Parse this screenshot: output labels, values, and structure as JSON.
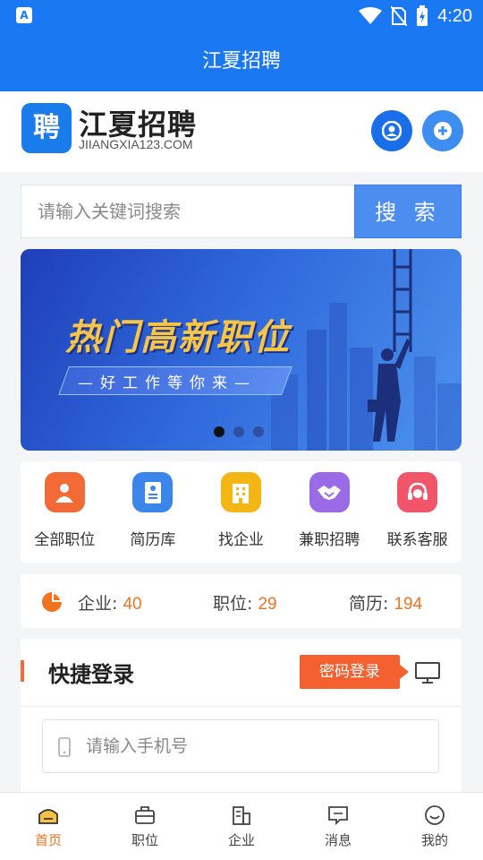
{
  "statusbar": {
    "time": "4:20",
    "app_badge": "A"
  },
  "titlebar": {
    "title": "江夏招聘"
  },
  "header": {
    "logo_char": "聘",
    "site_name": "江夏招聘",
    "domain": "JIIANGXIA123.COM"
  },
  "search": {
    "placeholder": "请输入关键词搜索",
    "button_label": "搜 索"
  },
  "banner": {
    "title": "热门高新职位",
    "subtitle": "—好工作等你来—",
    "slide_count": 3,
    "active_slide": 0
  },
  "menu": {
    "items": [
      {
        "label": "全部职位",
        "icon": "briefcase-person-icon",
        "color": "#f26a35"
      },
      {
        "label": "简历库",
        "icon": "resume-icon",
        "color": "#3a86ea"
      },
      {
        "label": "找企业",
        "icon": "building-icon",
        "color": "#f3b614"
      },
      {
        "label": "兼职招聘",
        "icon": "handshake-icon",
        "color": "#9b6ae6"
      },
      {
        "label": "联系客服",
        "icon": "headset-icon",
        "color": "#f0556a"
      }
    ]
  },
  "stats": {
    "company_label": "企业:",
    "company_count": "40",
    "job_label": "职位:",
    "job_count": "29",
    "resume_label": "简历:",
    "resume_count": "194"
  },
  "login": {
    "title": "快捷登录",
    "password_login_label": "密码登录",
    "phone_placeholder": "请输入手机号"
  },
  "tabbar": {
    "items": [
      {
        "label": "首页",
        "icon": "home-icon",
        "active": true
      },
      {
        "label": "职位",
        "icon": "briefcase-icon",
        "active": false
      },
      {
        "label": "企业",
        "icon": "company-icon",
        "active": false
      },
      {
        "label": "消息",
        "icon": "message-icon",
        "active": false
      },
      {
        "label": "我的",
        "icon": "profile-icon",
        "active": false
      }
    ]
  },
  "colors": {
    "primary": "#1a78f2",
    "accent": "#f2731e",
    "login_button": "#f4602f"
  }
}
